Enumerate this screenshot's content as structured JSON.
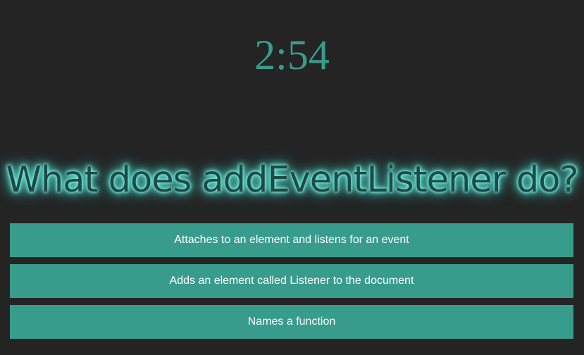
{
  "timer": {
    "display": "2:54"
  },
  "quiz": {
    "question": "What does addEventListener do?",
    "answers": [
      "Attaches to an element and listens for an event",
      "Adds an element called Listener to the document",
      "Names a function"
    ]
  },
  "colors": {
    "background": "#242424",
    "accent": "#389c8c",
    "timer": "#3a9b8c",
    "question_text": "#1f4a46",
    "glow": "#7ff3e6"
  }
}
